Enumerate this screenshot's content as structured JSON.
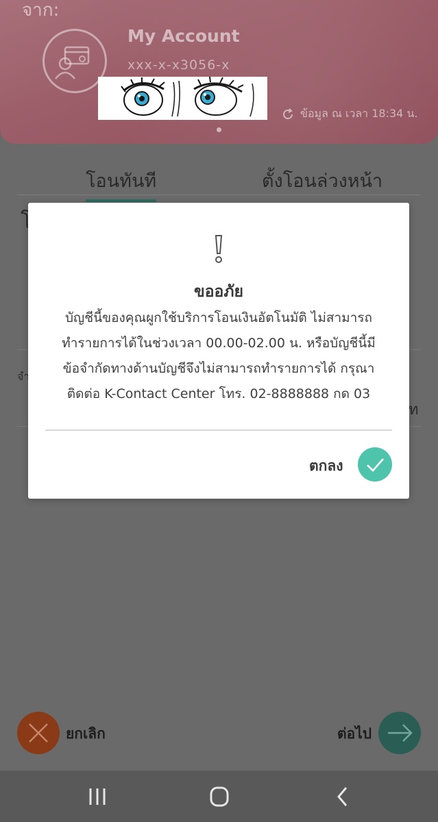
{
  "header": {
    "from_label": "จาก:",
    "account_name": "My Account",
    "account_number": "xxx-x-x3056-x",
    "updated_text": "ข้อมูล ณ เวลา 18:34 น."
  },
  "tabs": {
    "transfer_now": "โอนทันที",
    "schedule_transfer": "ตั้งโอนล่วงหน้า"
  },
  "background_fragments": {
    "frag1": "โ",
    "frag2": "จำ",
    "frag3": "ท"
  },
  "dialog": {
    "title": "ขออภัย",
    "body_lines": [
      "บัญชีนี้ของคุณผูกใช้บริการโอนเงินอัตโนมัติ ไม่สามารถ",
      "ทำรายการได้ในช่วงเวลา 00.00-02.00 น. หรือบัญชีนี้มี",
      "ข้อจำกัดทางด้านบัญชีจึงไม่สามารถทำรายการได้ กรุณา",
      "ติดต่อ K-Contact Center โทร. 02-8888888 กด 03"
    ],
    "ok_label": "ตกลง"
  },
  "actions": {
    "cancel_label": "ยกเลิก",
    "next_label": "ต่อไป"
  },
  "colors": {
    "header_pink": "#9b5d68",
    "accent_teal": "#4fc4ad",
    "cancel_orange": "#8a3a17",
    "next_teal": "#2a5e55"
  }
}
